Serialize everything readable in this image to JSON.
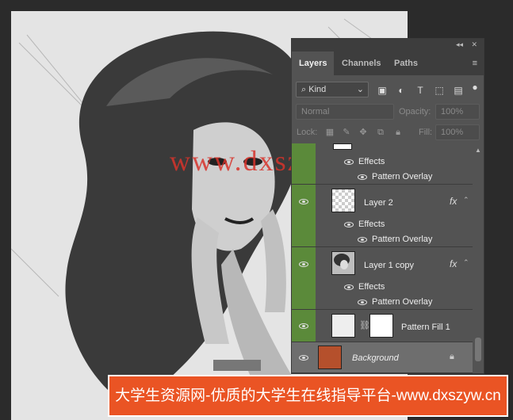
{
  "watermark_text": "www.dxszyw.cn",
  "banner_text": "大学生资源网-优质的大学生在线指导平台-www.dxszyw.cn",
  "panel": {
    "collapse_glyph": "◂◂",
    "close_glyph": "✕",
    "tabs": [
      {
        "label": "Layers"
      },
      {
        "label": "Channels"
      },
      {
        "label": "Paths"
      }
    ],
    "menu_glyph": "≡",
    "filter": {
      "label": "Kind",
      "icon": "search-icon"
    },
    "blend_mode": "Normal",
    "opacity_label": "Opacity:",
    "opacity_value": "100%",
    "lock_label": "Lock:",
    "fill_label": "Fill:",
    "fill_value": "100%"
  },
  "layers": {
    "top_partial": {
      "effects": "Effects",
      "pattern_overlay": "Pattern Overlay"
    },
    "layer2": {
      "name": "Layer 2",
      "fx": "fx",
      "effects": "Effects",
      "pattern_overlay": "Pattern Overlay"
    },
    "layer1copy": {
      "name": "Layer 1 copy",
      "fx": "fx",
      "effects": "Effects",
      "pattern_overlay": "Pattern Overlay"
    },
    "patternfill": {
      "name": "Pattern Fill 1"
    },
    "background": {
      "name": "Background"
    }
  },
  "colors": {
    "visibility_column": "#5b8a3a",
    "banner": "#ea5424",
    "watermark": "#d8332b"
  }
}
